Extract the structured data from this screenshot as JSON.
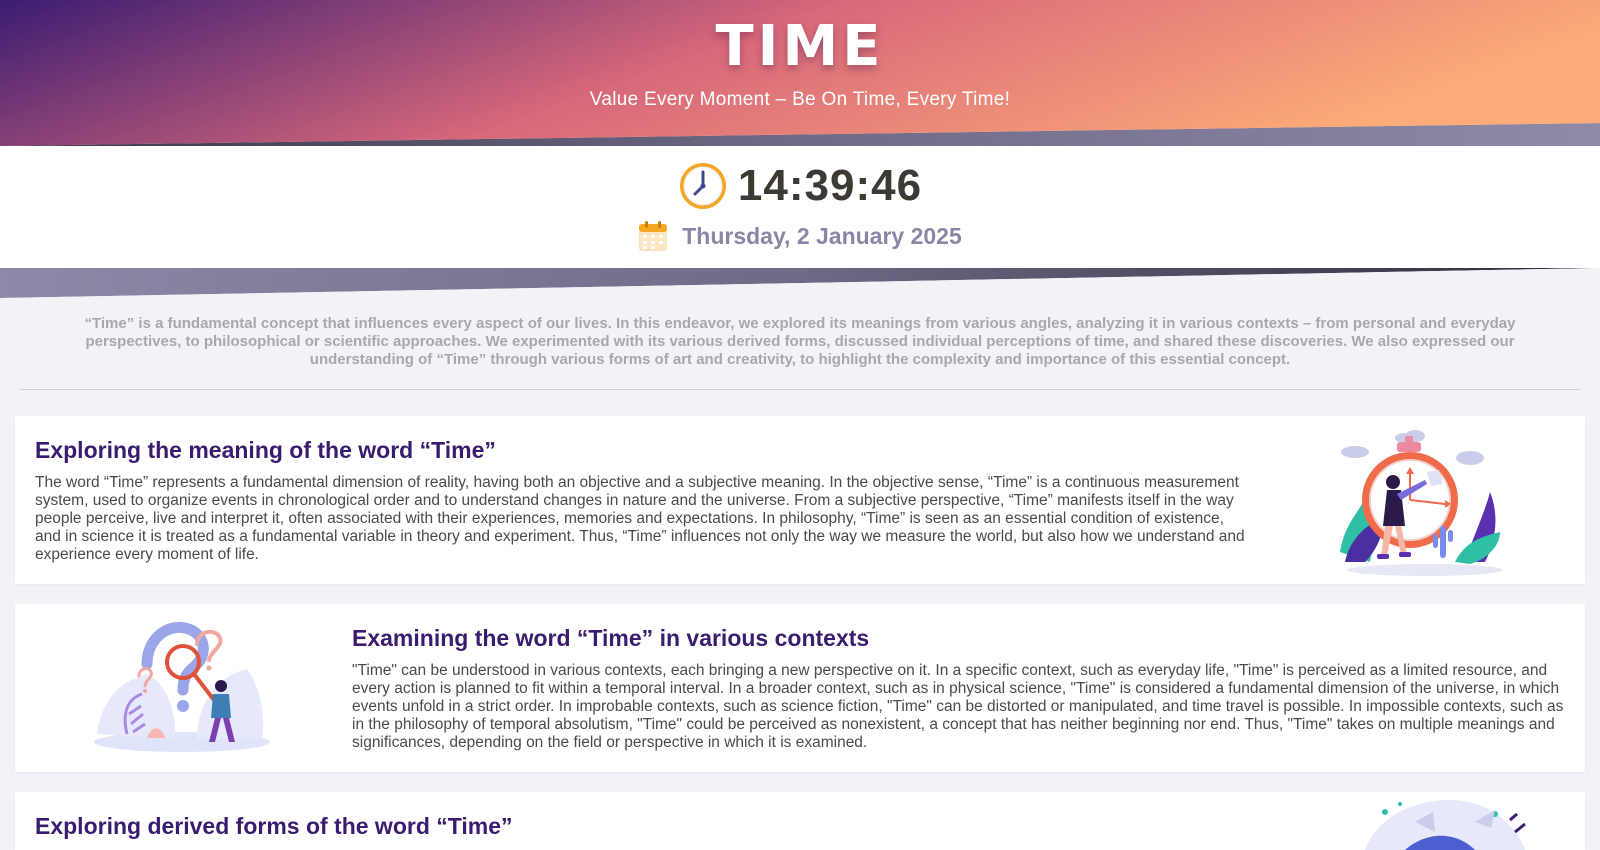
{
  "header": {
    "title": "TIME",
    "subtitle": "Value Every Moment – Be On Time, Every Time!"
  },
  "clock": {
    "time": "14:39:46",
    "date": "Thursday, 2 January 2025",
    "clock_icon": "clock-icon",
    "calendar_icon": "calendar-icon"
  },
  "intro": {
    "text": "“Time” is a fundamental concept that influences every aspect of our lives. In this endeavor, we explored its meanings from various angles, analyzing it in various contexts – from personal and everyday perspectives, to philosophical or scientific approaches. We experimented with its various derived forms, discussed individual perceptions of time, and shared these discoveries. We also expressed our understanding of “Time” through various forms of art and creativity, to highlight the complexity and importance of this essential concept."
  },
  "sections": [
    {
      "title": "Exploring the meaning of the word “Time”",
      "body": "The word “Time” represents a fundamental dimension of reality, having both an objective and a subjective meaning. In the objective sense, “Time” is a continuous measurement system, used to organize events in chronological order and to understand changes in nature and the universe. From a subjective perspective, “Time” manifests itself in the way people perceive, live and interpret it, often associated with their experiences, memories and expectations. In philosophy, “Time” is seen as an essential condition of existence, and in science it is treated as a fundamental variable in theory and experiment. Thus, “Time” influences not only the way we measure the world, but also how we understand and experience every moment of life.",
      "illustration": "stopwatch-woman-illustration"
    },
    {
      "title": "Examining the word “Time” in various contexts",
      "body": "\"Time\" can be understood in various contexts, each bringing a new perspective on it. In a specific context, such as everyday life, \"Time\" is perceived as a limited resource, and every action is planned to fit within a temporal interval. In a broader context, such as in physical science, \"Time\" is considered a fundamental dimension of the universe, in which events unfold in a strict order. In improbable contexts, such as science fiction, \"Time\" can be distorted or manipulated, and time travel is possible. In impossible contexts, such as in the philosophy of temporal absolutism, \"Time\" could be perceived as nonexistent, a concept that has neither beginning nor end. Thus, \"Time\" takes on multiple meanings and significances, depending on the field or perspective in which it is examined.",
      "illustration": "magnifier-question-illustration"
    },
    {
      "title": "Exploring derived forms of the word “Time”",
      "illustration": "abstract-splash-illustration"
    }
  ],
  "colors": {
    "hero_start": "#3b1c72",
    "hero_mid": "#d8687a",
    "hero_end": "#fdab78",
    "heading": "#3a1c6e",
    "date_text": "#8a86a6",
    "band": "#8a86a6"
  }
}
